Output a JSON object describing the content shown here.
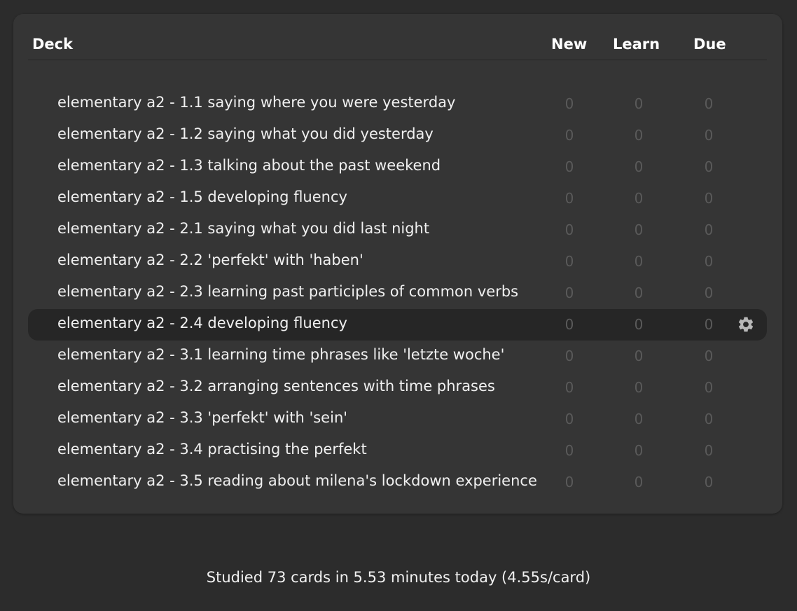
{
  "header": {
    "deck": "Deck",
    "new": "New",
    "learn": "Learn",
    "due": "Due"
  },
  "decks": [
    {
      "name": "elementary a2 - 1.1 saying where you were yesterday",
      "new": "0",
      "learn": "0",
      "due": "0"
    },
    {
      "name": "elementary a2 - 1.2 saying what you did yesterday",
      "new": "0",
      "learn": "0",
      "due": "0"
    },
    {
      "name": "elementary a2 - 1.3 talking about the past weekend",
      "new": "0",
      "learn": "0",
      "due": "0"
    },
    {
      "name": "elementary a2 - 1.5 developing fluency",
      "new": "0",
      "learn": "0",
      "due": "0"
    },
    {
      "name": "elementary a2 - 2.1 saying what you did last night",
      "new": "0",
      "learn": "0",
      "due": "0"
    },
    {
      "name": "elementary a2 - 2.2 'perfekt' with 'haben'",
      "new": "0",
      "learn": "0",
      "due": "0"
    },
    {
      "name": "elementary a2 - 2.3 learning past participles of common verbs",
      "new": "0",
      "learn": "0",
      "due": "0"
    },
    {
      "name": "elementary a2 - 2.4 developing fluency",
      "new": "0",
      "learn": "0",
      "due": "0"
    },
    {
      "name": "elementary a2 - 3.1 learning time phrases like 'letzte woche'",
      "new": "0",
      "learn": "0",
      "due": "0"
    },
    {
      "name": "elementary a2 - 3.2 arranging sentences with time phrases",
      "new": "0",
      "learn": "0",
      "due": "0"
    },
    {
      "name": "elementary a2 - 3.3 'perfekt' with 'sein'",
      "new": "0",
      "learn": "0",
      "due": "0"
    },
    {
      "name": "elementary a2 - 3.4 practising the perfekt",
      "new": "0",
      "learn": "0",
      "due": "0"
    },
    {
      "name": "elementary a2 - 3.5 reading about milena's lockdown experience",
      "new": "0",
      "learn": "0",
      "due": "0"
    }
  ],
  "current_deck_index": 7,
  "gear_icon": "gear-icon",
  "footer": {
    "stats": "Studied 73 cards in 5.53 minutes today (4.55s/card)"
  },
  "colors": {
    "background": "#2c2c2c",
    "panel": "#353535",
    "current_row": "#262626",
    "zero_count": "#5a5a5a"
  }
}
